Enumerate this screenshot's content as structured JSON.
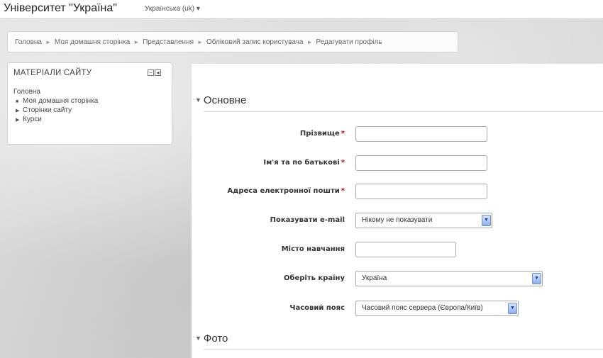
{
  "header": {
    "site_name": "Університет \"Україна\"",
    "language": "Українська (uk) ▾"
  },
  "breadcrumb": {
    "items": [
      "Головна",
      "Моя домашня сторінка",
      "Представлення",
      "Обліковий запис користувача",
      "Редагувати профіль"
    ],
    "separator": "►"
  },
  "sidebar_block": {
    "title": "МАТЕРІАЛИ САЙТУ",
    "home": "Головна",
    "items": [
      {
        "label": "Моя домашня сторінка",
        "marker": "■"
      },
      {
        "label": "Сторінки сайту",
        "marker": "▶"
      },
      {
        "label": "Курси",
        "marker": "▶"
      }
    ]
  },
  "form": {
    "section_general": "Основне",
    "section_photo": "Фото",
    "fields": {
      "surname": {
        "label": "Прізвище",
        "required_mark": "*",
        "value": ""
      },
      "firstname": {
        "label": "Ім'я та по батькові",
        "required_mark": "*",
        "value": ""
      },
      "email": {
        "label": "Адреса електронної пошти",
        "required_mark": "*",
        "value": ""
      },
      "show_email": {
        "label": "Показувати e-mail",
        "selected": "Нікому не показувати"
      },
      "city": {
        "label": "Місто навчання",
        "value": ""
      },
      "country": {
        "label": "Оберіть країну",
        "selected": "Україна"
      },
      "timezone": {
        "label": "Часовий пояс",
        "selected": "Часовий пояс сервера (Європа/Київ)"
      }
    }
  },
  "colors": {
    "required": "#cc0000",
    "select_button": "#8fb0ee"
  }
}
